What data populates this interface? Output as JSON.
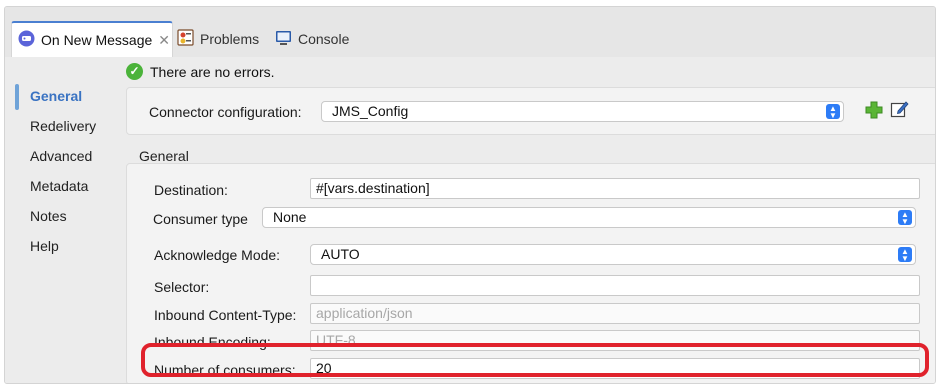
{
  "tabs": {
    "active": {
      "label": "On New Message",
      "close": "✕"
    },
    "problems": {
      "label": "Problems"
    },
    "console": {
      "label": "Console"
    }
  },
  "sidebar": {
    "items": [
      {
        "label": "General",
        "active": true
      },
      {
        "label": "Redelivery"
      },
      {
        "label": "Advanced"
      },
      {
        "label": "Metadata"
      },
      {
        "label": "Notes"
      },
      {
        "label": "Help"
      }
    ]
  },
  "status": {
    "message": "There are no errors."
  },
  "connector": {
    "label": "Connector configuration:",
    "value": "JMS_Config"
  },
  "general": {
    "heading": "General",
    "destination": {
      "label": "Destination:",
      "value": "#[vars.destination]"
    },
    "consumer_type": {
      "label": "Consumer type",
      "value": "None"
    },
    "ack_mode": {
      "label": "Acknowledge Mode:",
      "value": "AUTO"
    },
    "selector": {
      "label": "Selector:",
      "value": ""
    },
    "inbound_content_type": {
      "label": "Inbound Content-Type:",
      "placeholder": "application/json"
    },
    "inbound_encoding": {
      "label": "Inbound Encoding:",
      "placeholder": "UTF-8"
    },
    "num_consumers": {
      "label": "Number of consumers:",
      "value": "20"
    }
  },
  "colors": {
    "accent": "#3a73c2",
    "highlight": "#e0222c",
    "ok": "#4bb33a",
    "spinner": "#2d7cf6"
  }
}
